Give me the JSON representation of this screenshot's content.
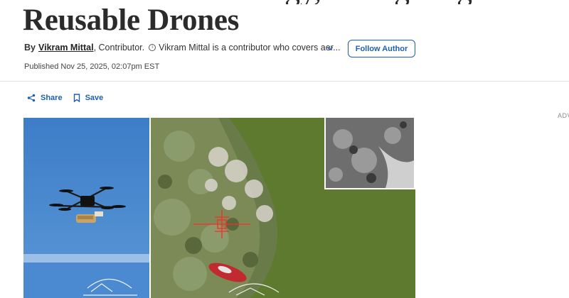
{
  "article": {
    "headline_line2": "Reusable Drones",
    "byline": {
      "by": "By",
      "author": "Vikram Mittal",
      "role": ", Contributor.",
      "info_icon": "info-icon",
      "description": "Vikram Mittal is a contributor who covers aer..."
    },
    "follow_label": "Follow Author",
    "published": "Published Nov 25, 2025, 02:07pm EST"
  },
  "actions": {
    "share_label": "Share",
    "save_label": "Save"
  },
  "ad_label": "ADV",
  "colors": {
    "accent": "#1f5fb0",
    "text": "#333333",
    "headline": "#2b2b2b",
    "divider": "#e1e1e1"
  },
  "media": {
    "left_image": "quadcopter drone in blue sky",
    "right_image": "aerial drone view of vegetation and river with targeting reticle"
  }
}
